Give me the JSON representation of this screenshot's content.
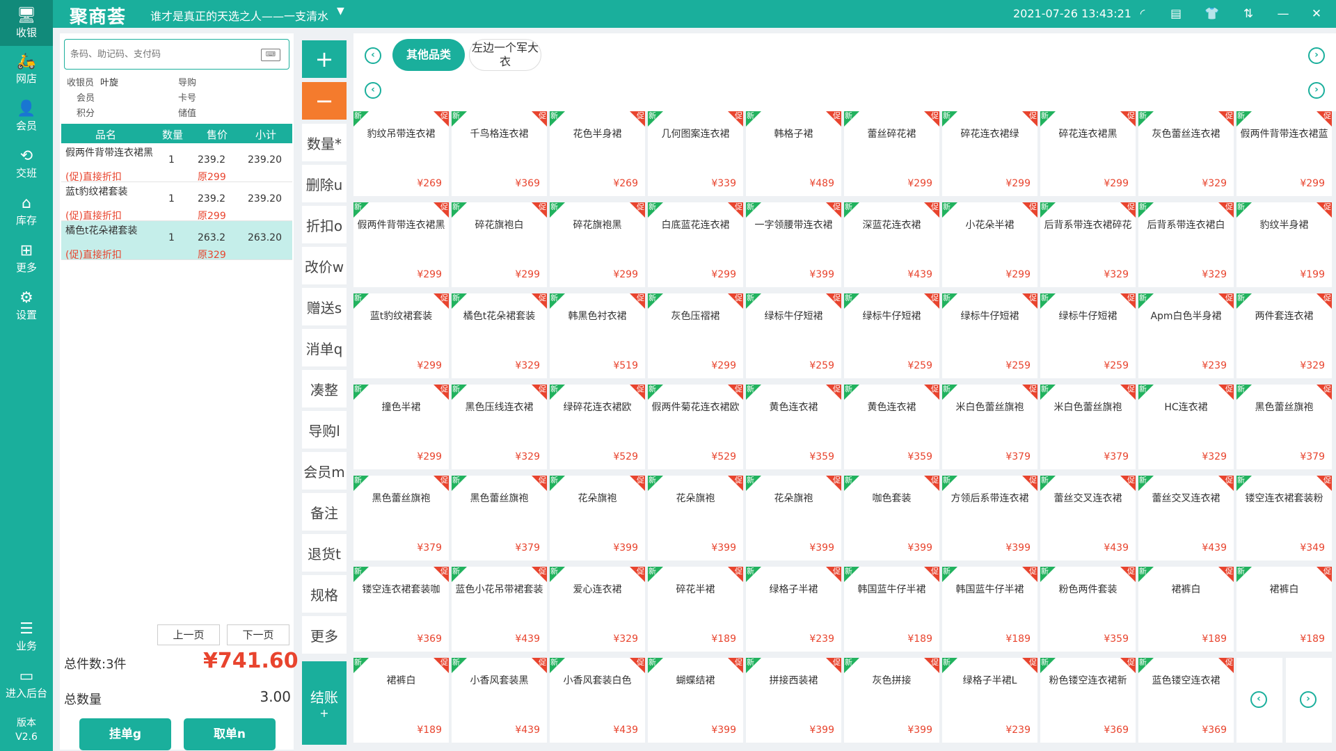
{
  "topbar": {
    "logo": "聚商荟",
    "slogan": "谁才是真正的天选之人——一支清水",
    "slogan_dropdown": "▼",
    "datetime": "2021-07-26 13:43:21",
    "icons": {
      "wifi": "◜",
      "message": "▤",
      "shirt": "👕",
      "switch": "⇅",
      "minimize": "—",
      "close": "✕"
    }
  },
  "sidebar": {
    "items": [
      {
        "label": "收银",
        "icon": "🖥"
      },
      {
        "label": "网店",
        "icon": "🛵"
      },
      {
        "label": "会员",
        "icon": "👤"
      },
      {
        "label": "交班",
        "icon": "⟲"
      },
      {
        "label": "库存",
        "icon": "⌂"
      },
      {
        "label": "更多",
        "icon": "⊞"
      },
      {
        "label": "设置",
        "icon": "⚙"
      },
      {
        "label": "业务",
        "icon": "☰"
      },
      {
        "label": "进入后台",
        "icon": "▭"
      }
    ],
    "version_label": "版本",
    "version": "V2.6"
  },
  "left": {
    "search_placeholder": "条码、助记码、支付码",
    "keyboard_icon": "⌨",
    "cashier_label": "收银员",
    "cashier": "叶旋",
    "guide_label": "导购",
    "member_label": "会员",
    "card_label": "卡号",
    "points_label": "积分",
    "stored_label": "储值",
    "headers": {
      "name": "品名",
      "qty": "数量",
      "price": "售价",
      "subtotal": "小计"
    },
    "rows": [
      {
        "name": "假两件背带连衣裙黑",
        "promo": "(促)直接折扣",
        "qty": "1",
        "price": "239.2",
        "subtotal": "239.20",
        "original": "原299"
      },
      {
        "name": "蓝t豹纹裙套装",
        "promo": "(促)直接折扣",
        "qty": "1",
        "price": "239.2",
        "subtotal": "239.20",
        "original": "原299"
      },
      {
        "name": "橘色t花朵裙套装",
        "promo": "(促)直接折扣",
        "qty": "1",
        "price": "263.2",
        "subtotal": "263.20",
        "original": "原329"
      }
    ],
    "prev_page": "上一页",
    "next_page": "下一页",
    "total_items": "总件数:3件",
    "total_amount": "¥741.60",
    "total_qty_label": "总数量",
    "total_qty": "3.00",
    "hold_button": "挂单g",
    "retrieve_button": "取单n"
  },
  "actions": {
    "plus": "+",
    "minus": "−",
    "buttons": [
      "数量*",
      "删除u",
      "折扣o",
      "改价w",
      "赠送s",
      "消单q",
      "凑整",
      "导购l",
      "会员m",
      "备注",
      "退货t",
      "规格",
      "更多"
    ],
    "checkout": "结账",
    "checkout_sub": "+"
  },
  "categories": {
    "prev": "‹",
    "next": "›",
    "items": [
      "其他品类",
      "左边一个军大衣"
    ]
  },
  "product_badges": {
    "new": "新",
    "promo": "促"
  },
  "products": [
    {
      "name": "豹纹吊带连衣裙",
      "price": "¥269"
    },
    {
      "name": "千鸟格连衣裙",
      "price": "¥369"
    },
    {
      "name": "花色半身裙",
      "price": "¥269"
    },
    {
      "name": "几何图案连衣裙",
      "price": "¥339"
    },
    {
      "name": "韩格子裙",
      "price": "¥489"
    },
    {
      "name": "蕾丝碎花裙",
      "price": "¥299"
    },
    {
      "name": "碎花连衣裙绿",
      "price": "¥299"
    },
    {
      "name": "碎花连衣裙黑",
      "price": "¥299"
    },
    {
      "name": "灰色蕾丝连衣裙",
      "price": "¥329"
    },
    {
      "name": "假两件背带连衣裙蓝",
      "price": "¥299"
    },
    {
      "name": "假两件背带连衣裙黑",
      "price": "¥299"
    },
    {
      "name": "碎花旗袍白",
      "price": "¥299"
    },
    {
      "name": "碎花旗袍黑",
      "price": "¥299"
    },
    {
      "name": "白底蓝花连衣裙",
      "price": "¥299"
    },
    {
      "name": "一字领腰带连衣裙",
      "price": "¥399"
    },
    {
      "name": "深蓝花连衣裙",
      "price": "¥439"
    },
    {
      "name": "小花朵半裙",
      "price": "¥299"
    },
    {
      "name": "后背系带连衣裙碎花",
      "price": "¥329"
    },
    {
      "name": "后背系带连衣裙白",
      "price": "¥329"
    },
    {
      "name": "豹纹半身裙",
      "price": "¥199"
    },
    {
      "name": "蓝t豹纹裙套装",
      "price": "¥299"
    },
    {
      "name": "橘色t花朵裙套装",
      "price": "¥329"
    },
    {
      "name": "韩黑色衬衣裙",
      "price": "¥519"
    },
    {
      "name": "灰色压褶裙",
      "price": "¥299"
    },
    {
      "name": "绿标牛仔短裙",
      "price": "¥259"
    },
    {
      "name": "绿标牛仔短裙",
      "price": "¥259"
    },
    {
      "name": "绿标牛仔短裙",
      "price": "¥259"
    },
    {
      "name": "绿标牛仔短裙",
      "price": "¥259"
    },
    {
      "name": "Apm白色半身裙",
      "price": "¥239"
    },
    {
      "name": "两件套连衣裙",
      "price": "¥329"
    },
    {
      "name": "撞色半裙",
      "price": "¥299"
    },
    {
      "name": "黑色压线连衣裙",
      "price": "¥329"
    },
    {
      "name": "绿碎花连衣裙欧",
      "price": "¥529"
    },
    {
      "name": "假两件菊花连衣裙欧",
      "price": "¥529"
    },
    {
      "name": "黄色连衣裙",
      "price": "¥359"
    },
    {
      "name": "黄色连衣裙",
      "price": "¥359"
    },
    {
      "name": "米白色蕾丝旗袍",
      "price": "¥379"
    },
    {
      "name": "米白色蕾丝旗袍",
      "price": "¥379"
    },
    {
      "name": "HC连衣裙",
      "price": "¥329"
    },
    {
      "name": "黑色蕾丝旗袍",
      "price": "¥379"
    },
    {
      "name": "黑色蕾丝旗袍",
      "price": "¥379"
    },
    {
      "name": "黑色蕾丝旗袍",
      "price": "¥379"
    },
    {
      "name": "花朵旗袍",
      "price": "¥399"
    },
    {
      "name": "花朵旗袍",
      "price": "¥399"
    },
    {
      "name": "花朵旗袍",
      "price": "¥399"
    },
    {
      "name": "咖色套装",
      "price": "¥399"
    },
    {
      "name": "方领后系带连衣裙",
      "price": "¥399"
    },
    {
      "name": "蕾丝交叉连衣裙",
      "price": "¥439"
    },
    {
      "name": "蕾丝交叉连衣裙",
      "price": "¥439"
    },
    {
      "name": "镂空连衣裙套装粉",
      "price": "¥349"
    },
    {
      "name": "镂空连衣裙套装咖",
      "price": "¥369"
    },
    {
      "name": "蓝色小花吊带裙套装",
      "price": "¥439"
    },
    {
      "name": "爱心连衣裙",
      "price": "¥329"
    },
    {
      "name": "碎花半裙",
      "price": "¥189"
    },
    {
      "name": "绿格子半裙",
      "price": "¥239"
    },
    {
      "name": "韩国蓝牛仔半裙",
      "price": "¥189"
    },
    {
      "name": "韩国蓝牛仔半裙",
      "price": "¥189"
    },
    {
      "name": "粉色两件套装",
      "price": "¥359"
    },
    {
      "name": "裙裤白",
      "price": "¥189"
    },
    {
      "name": "裙裤白",
      "price": "¥189"
    },
    {
      "name": "裙裤白",
      "price": "¥189"
    },
    {
      "name": "小香风套装黑",
      "price": "¥439"
    },
    {
      "name": "小香风套装白色",
      "price": "¥439"
    },
    {
      "name": "蝴蝶结裙",
      "price": "¥399"
    },
    {
      "name": "拼接西装裙",
      "price": "¥399"
    },
    {
      "name": "灰色拼接",
      "price": "¥399"
    },
    {
      "name": "绿格子半裙L",
      "price": "¥239"
    },
    {
      "name": "粉色镂空连衣裙新",
      "price": "¥369"
    },
    {
      "name": "蓝色镂空连衣裙",
      "price": "¥369"
    }
  ],
  "grid_nav": {
    "prev": "‹",
    "next": "›"
  },
  "colors": {
    "primary": "#1aaf9c",
    "promo": "#e8442e",
    "new_badge": "#21b25e",
    "minus_button": "#f47b2d"
  }
}
